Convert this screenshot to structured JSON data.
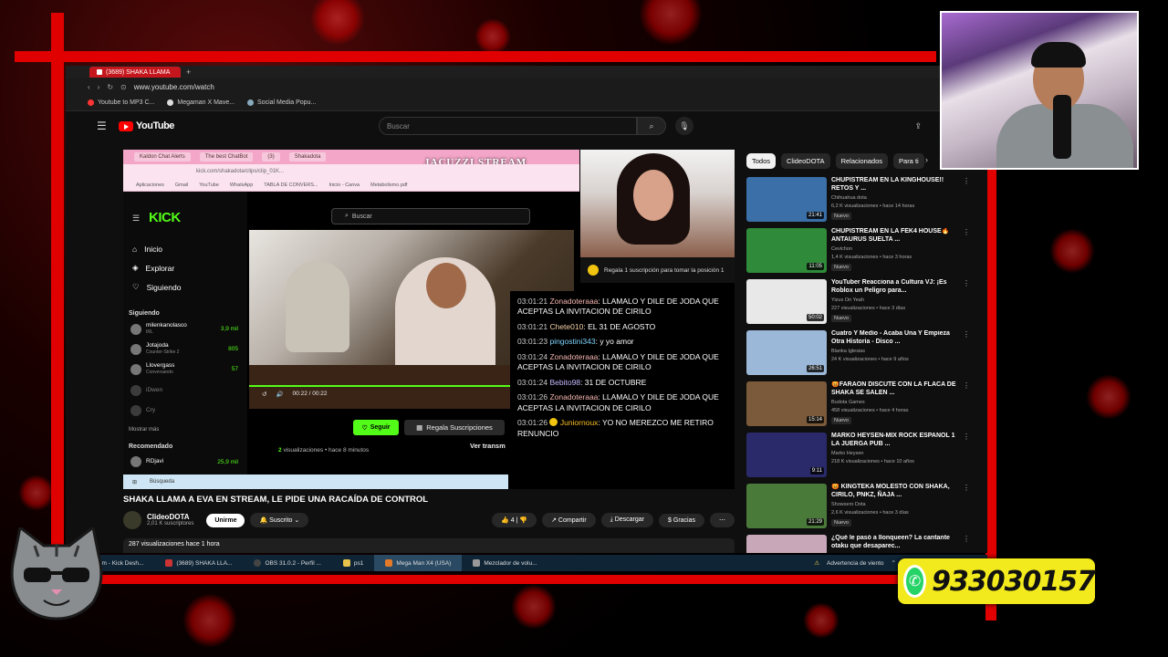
{
  "browser": {
    "tab_title": "(3689) SHAKA LLAMA",
    "url": "www.youtube.com/watch",
    "bookmarks": [
      "Youtube to MP3 C...",
      "Megaman X Mave...",
      "Social Media Popu..."
    ]
  },
  "youtube": {
    "logo_text": "YouTube",
    "search_placeholder": "Buscar",
    "video_title": "SHAKA LLAMA A EVA EN STREAM, LE PIDE UNA RACAÍDA DE CONTROL",
    "channel_name": "ClideoDOTA",
    "channel_subs": "2,01 K suscriptores",
    "join_label": "Unirme",
    "subscribed_label": "Suscrito",
    "likes": "4",
    "share_label": "Compartir",
    "download_label": "Descargar",
    "thanks_label": "Gracias",
    "views_line": "287 visualizaciones  hace 1 hora",
    "chips": [
      "Todos",
      "ClideoDOTA",
      "Relacionados",
      "Para ti"
    ]
  },
  "stream": {
    "banner": "JACUZZI STREAM",
    "inner_url": "kick.com/shakadota/clips/clip_01K...",
    "kick_logo": "KICK",
    "kick_search": "Buscar",
    "nav": [
      "Inicio",
      "Explorar",
      "Siguiendo"
    ],
    "following_header": "Siguiendo",
    "following": [
      {
        "name": "milenkanolasco",
        "sub": "IRL",
        "count": "3,9 mil"
      },
      {
        "name": "Jotajoda",
        "sub": "Counter-Strike 2",
        "count": "805"
      },
      {
        "name": "Llovergass",
        "sub": "Conversando",
        "count": "57"
      },
      {
        "name": "iDwen",
        "sub": "",
        "count": ""
      },
      {
        "name": "Cry",
        "sub": "",
        "count": ""
      }
    ],
    "show_more": "Mostrar más",
    "recommended_header": "Recomendado",
    "recommended": [
      {
        "name": "RDjavi",
        "count": "25,9 mil"
      }
    ],
    "video_time": "00:22 / 00:22",
    "follow_label": "Seguir",
    "gift_label": "Regala Suscripciones",
    "views_prefix": "2",
    "views_text": "visualizaciones • hace 8 minutos",
    "ver_label": "Ver transm",
    "win_search": "Búsqueda",
    "gift_note": "Regala 1 suscripción para tomar la posición 1"
  },
  "chat": [
    {
      "time": "03:01:21",
      "user": "Zonadoteraaa",
      "cls": "u1",
      "text": "LLAMALO Y DILE DE JODA QUE ACEPTAS LA INVITACION DE CIRILO"
    },
    {
      "time": "03:01:21",
      "user": "Chete010",
      "cls": "u2",
      "text": "EL 31 DE AGOSTO"
    },
    {
      "time": "03:01:23",
      "user": "pingostini343",
      "cls": "u3",
      "text": "y yo amor"
    },
    {
      "time": "03:01:24",
      "user": "Zonadoteraaa",
      "cls": "u1",
      "text": "LLAMALO Y DILE DE JODA QUE ACEPTAS LA INVITACION DE CIRILO"
    },
    {
      "time": "03:01:24",
      "user": "Bebito98",
      "cls": "u4",
      "text": "31 DE OCTUBRE"
    },
    {
      "time": "03:01:26",
      "user": "Zonadoteraaa",
      "cls": "u1",
      "text": "LLAMALO Y DILE DE JODA QUE ACEPTAS LA INVITACION DE CIRILO"
    },
    {
      "time": "03:01:26",
      "user": "Juniornoux",
      "cls": "u5",
      "text": "YO NO MEREZCO ME RETIRO RENUNCIO"
    }
  ],
  "recommendations": [
    {
      "title": "CHUPISTREAM EN LA KINGHOUSE!! RETOS Y ...",
      "channel": "Chihuahua dota",
      "meta": "6,2 K visualizaciones • hace 14 horas",
      "badge": "Nuevo",
      "duration": "21:41",
      "color": "#3b6fa8"
    },
    {
      "title": "CHUPISTREAM EN LA FEK4 HOUSE🔥ANTAURUS SUELTA ...",
      "channel": "Cevichon",
      "meta": "1,4 K visualizaciones • hace 3 horas",
      "badge": "Nuevo",
      "duration": "11:05",
      "color": "#2f8a3a"
    },
    {
      "title": "YouTuber Reacciona a Cultura VJ: ¡Es Roblox un Peligro para...",
      "channel": "Yizus On Yeah",
      "meta": "227 visualizaciones • hace 3 días",
      "badge": "Nuevo",
      "duration": "50:02",
      "color": "#e8e8e8"
    },
    {
      "title": "Cuatro Y Medio - Acaba Una Y Empieza Otra Historia - Disco ...",
      "channel": "Blanka Iglesias",
      "meta": "24 K visualizaciones • hace 9 años",
      "badge": "",
      "duration": "26:51",
      "color": "#9bb8d8"
    },
    {
      "title": "😡FARAON DISCUTE CON LA FLACA DE SHAKA SE SALEN ...",
      "channel": "Budota Games",
      "meta": "458 visualizaciones • hace 4 horas",
      "badge": "Nuevo",
      "duration": "15:14",
      "color": "#7a5a3a"
    },
    {
      "title": "MARKO HEYSEN-MIX ROCK ESPAÑOL 1 LA JUERGA PUB ...",
      "channel": "Marko Heysen",
      "meta": "218 K visualizaciones • hace 10 años",
      "badge": "",
      "duration": "9:11",
      "color": "#2a2a6a"
    },
    {
      "title": "😡 KINGTEKA MOLESTO CON SHAKA, CIRILO, PNKZ, ÑAJA ...",
      "channel": "Showsero Dota",
      "meta": "2,6 K visualizaciones • hace 3 días",
      "badge": "Nuevo",
      "duration": "21:29",
      "color": "#4a7a3a"
    },
    {
      "title": "¿Qué le pasó a Ilonqueen? La cantante otaku que desaparec...",
      "channel": "",
      "meta": "",
      "badge": "",
      "duration": "",
      "color": "#c8a8b8"
    }
  ],
  "taskbar": {
    "items": [
      "Stream - Kick Desh...",
      "(3689) SHAKA LLA...",
      "OBS 31.0.2 - Perfil ...",
      "ps1",
      "Mega Man X4 (USA)",
      "Mezclador de volu..."
    ],
    "weather": "Advertencia de viento"
  },
  "overlay": {
    "phone": "933030157"
  }
}
